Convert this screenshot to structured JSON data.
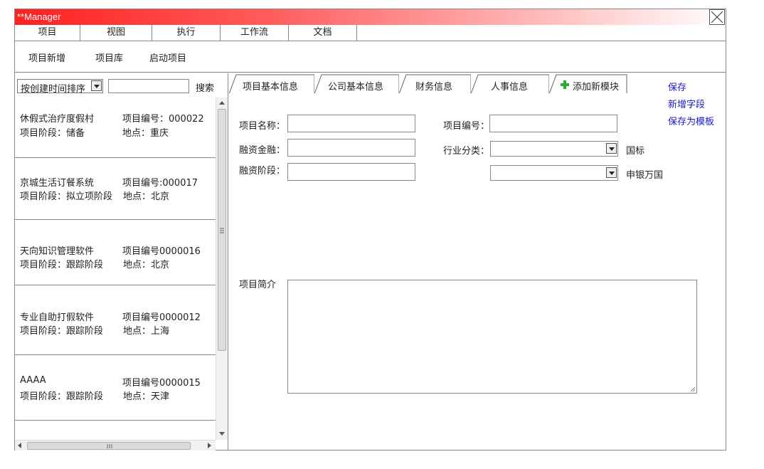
{
  "window": {
    "title": "**Manager"
  },
  "menu": [
    "项目",
    "视图",
    "执行",
    "工作流",
    "文档"
  ],
  "toolbar": [
    "项目新增",
    "项目库",
    "启动项目"
  ],
  "left": {
    "sort_value": "按创建时间排序",
    "search_value": "",
    "search_label": "搜索",
    "projects": [
      {
        "name": "休假式治疗度假村",
        "number": "项目编号：000022",
        "stage": "项目阶段：储备",
        "location": "地点：重庆"
      },
      {
        "name": "京城生活订餐系统",
        "number": "项目编号:000017",
        "stage": "项目阶段：拟立项阶段",
        "location": "地点：北京"
      },
      {
        "name": "天向知识管理软件",
        "number": "项目编号0000016",
        "stage": "项目阶段：跟踪阶段",
        "location": "地点：北京"
      },
      {
        "name": "专业自助打假软件",
        "number": "项目编号0000012",
        "stage": "项目阶段：跟踪阶段",
        "location": "地点：上海"
      },
      {
        "name": "AAAA",
        "number": "项目编号0000015",
        "stage": "项目阶段：跟踪阶段",
        "location": "地点：天津"
      }
    ]
  },
  "tabs": [
    "项目基本信息",
    "公司基本信息",
    "财务信息",
    "人事信息",
    "添加新模块"
  ],
  "side_links": [
    "保存",
    "新增字段",
    "保存为模板"
  ],
  "form": {
    "project_name_label": "项目名称：",
    "project_name_value": "",
    "project_number_label": "项目编号：",
    "project_number_value": "",
    "financing_amount_label": "融资金融：",
    "financing_amount_value": "",
    "industry_label": "行业分类：",
    "industry_value": "",
    "industry_std": "国标",
    "financing_stage_label": "融资阶段：",
    "financing_stage_value": "",
    "industry2_value": "",
    "industry2_std": "申银万国",
    "summary_label": "项目简介",
    "summary_value": ""
  },
  "colors": {
    "title_start": "#ff1f1f",
    "title_end": "#ffffff",
    "link": "#1a1acc",
    "add_icon": "#2eaa2e"
  }
}
